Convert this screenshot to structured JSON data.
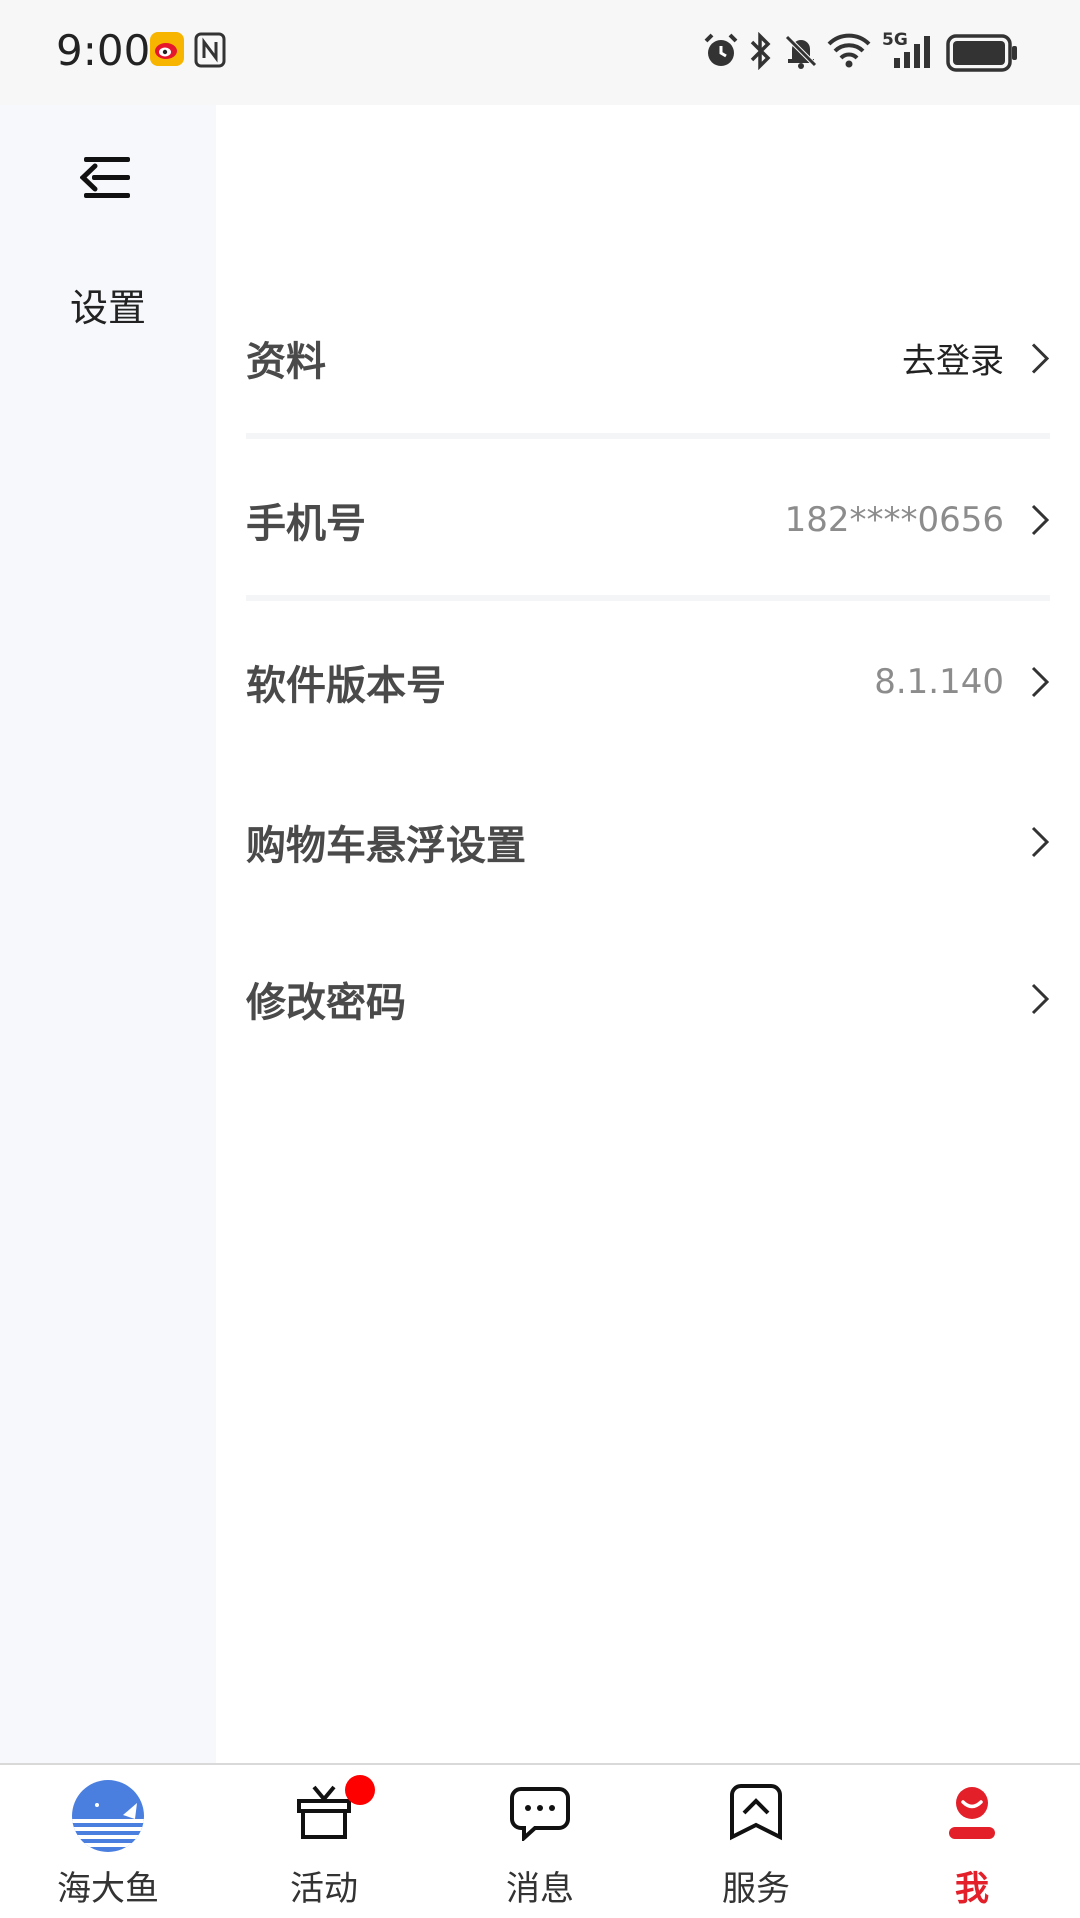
{
  "status_bar": {
    "time": "9:00",
    "icons": [
      "weibo-icon",
      "nfc-icon",
      "alarm-icon",
      "bluetooth-icon",
      "mute-icon",
      "wifi-icon",
      "5g-signal-icon",
      "battery-icon"
    ],
    "network_label": "5G"
  },
  "sidebar": {
    "title": "设置"
  },
  "settings": [
    {
      "label": "资料",
      "value": "去登录"
    },
    {
      "label": "手机号",
      "value": "182****0656"
    },
    {
      "label": "软件版本号",
      "value": "8.1.140"
    },
    {
      "label": "购物车悬浮设置",
      "value": ""
    },
    {
      "label": "修改密码",
      "value": ""
    }
  ],
  "bottom_nav": {
    "items": [
      {
        "label": "海大鱼",
        "icon": "whale-logo-icon"
      },
      {
        "label": "活动",
        "icon": "gift-icon"
      },
      {
        "label": "消息",
        "icon": "chat-bubble-icon"
      },
      {
        "label": "服务",
        "icon": "bookmark-icon"
      },
      {
        "label": "我",
        "icon": "user-icon"
      }
    ],
    "active_index": 4
  },
  "colors": {
    "accent": "#e3202a",
    "badge": "#ff0000",
    "sidebar_bg": "#f6f8fc",
    "label_text": "#4a4a4a",
    "value_grey": "#8c8c8c"
  }
}
